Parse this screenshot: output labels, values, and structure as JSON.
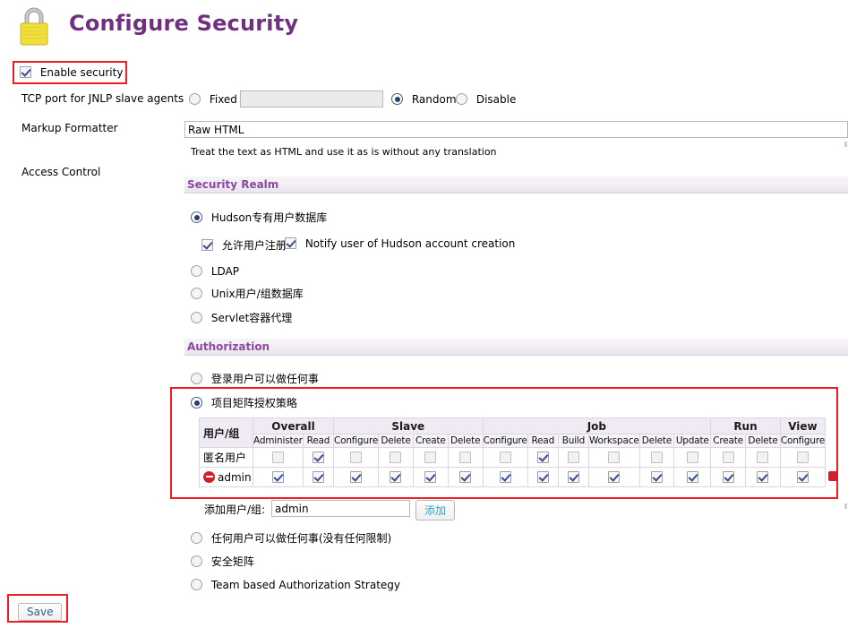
{
  "page": {
    "title": "Configure Security",
    "lock_icon": "padlock-icon",
    "title_color": "#71307f",
    "highlight_color": "#ee1c25"
  },
  "enable_security": {
    "label": "Enable security",
    "checked": true
  },
  "jnlp": {
    "label": "TCP port for JNLP slave agents",
    "fixed_label": "Fixed :",
    "fixed_value": "",
    "fixed_selected": false,
    "random_label": "Random",
    "random_selected": true,
    "disable_label": "Disable",
    "disable_selected": false
  },
  "markup_formatter": {
    "label": "Markup Formatter",
    "value": "Raw HTML",
    "help": "Treat the text as HTML and use it as is without any translation"
  },
  "access_control": {
    "label": "Access Control"
  },
  "security_realm": {
    "section_title": "Security Realm",
    "options": [
      {
        "label": "Hudson专有用户数据库",
        "selected": true
      },
      {
        "label": "LDAP",
        "selected": false
      },
      {
        "label": "Unix用户/组数据库",
        "selected": false
      },
      {
        "label": "Servlet容器代理",
        "selected": false
      }
    ],
    "sub_options": [
      {
        "label": "允许用户注册",
        "checked": true
      },
      {
        "label": "Notify user of Hudson account creation",
        "checked": true
      }
    ]
  },
  "authorization": {
    "section_title": "Authorization",
    "options": [
      {
        "label": "登录用户可以做任何事",
        "selected": false
      },
      {
        "label": "项目矩阵授权策略",
        "selected": true
      },
      {
        "label": "任何用户可以做任何事(没有任何限制)",
        "selected": false
      },
      {
        "label": "安全矩阵",
        "selected": false
      },
      {
        "label": "Team based Authorization Strategy",
        "selected": false
      }
    ]
  },
  "matrix": {
    "corner_header": "用户/组",
    "groups": [
      {
        "name": "Overall",
        "span": 2
      },
      {
        "name": "Slave",
        "span": 4
      },
      {
        "name": "Job",
        "span": 6
      },
      {
        "name": "Run",
        "span": 2
      },
      {
        "name": "View",
        "span": 3
      }
    ],
    "columns": [
      "Administer",
      "Read",
      "Configure",
      "Delete",
      "Create",
      "Delete",
      "Configure",
      "Read",
      "Build",
      "Workspace",
      "Delete",
      "Update",
      "Create",
      "Delete",
      "Configure"
    ],
    "rows": [
      {
        "name": "匿名用户",
        "deletable": false,
        "values": [
          false,
          true,
          false,
          false,
          false,
          false,
          false,
          true,
          false,
          false,
          false,
          false,
          false,
          false,
          false
        ]
      },
      {
        "name": "admin",
        "deletable": true,
        "values": [
          true,
          true,
          true,
          true,
          true,
          true,
          true,
          true,
          true,
          true,
          true,
          true,
          true,
          true,
          true
        ]
      }
    ]
  },
  "add_user": {
    "label": "添加用户/组:",
    "value": "admin",
    "button_label": "添加"
  },
  "save": {
    "label": "Save"
  }
}
